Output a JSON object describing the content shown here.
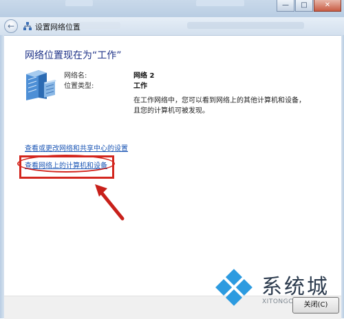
{
  "window": {
    "title": "设置网络位置",
    "controls": {
      "minimize": "—",
      "maximize": "□",
      "close": "✕"
    }
  },
  "main": {
    "heading": "网络位置现在为“工作”",
    "info": {
      "network_name_label": "网络名:",
      "network_name_value": "网络 2",
      "location_type_label": "位置类型:",
      "location_type_value": "工作"
    },
    "description": "在工作网络中，您可以看到网络上的其他计算机和设备，且您的计算机可被发现。",
    "links": {
      "sharing_center": "查看或更改网络和共享中心的设置",
      "view_computers": "查看网络上的计算机和设备"
    }
  },
  "footer": {
    "close_button_label": "关闭(C)"
  },
  "watermark": {
    "brand": "系统城",
    "url": "XITONGCHENG.COM"
  },
  "icons": {
    "back": "back-arrow-icon",
    "network": "network-icon",
    "server": "server-icon",
    "annotation_arrow": "red-arrow-icon"
  },
  "colors": {
    "heading": "#1e3287",
    "link": "#1b56b5",
    "annotation": "#d3261e"
  }
}
